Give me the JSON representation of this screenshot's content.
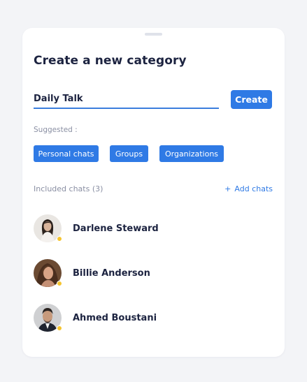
{
  "dialog": {
    "title": "Create a new category",
    "name_input_value": "Daily Talk",
    "create_label": "Create"
  },
  "suggested": {
    "label": "Suggested :",
    "chips": [
      "Personal chats",
      "Groups",
      "Organizations"
    ]
  },
  "included": {
    "label": "Included chats (3)",
    "add_label": "Add chats",
    "add_icon": "+",
    "chats": [
      {
        "name": "Darlene Steward",
        "status": "away"
      },
      {
        "name": "Billie Anderson",
        "status": "away"
      },
      {
        "name": "Ahmed Boustani",
        "status": "away"
      }
    ]
  },
  "colors": {
    "accent": "#2f7ae5",
    "status_away": "#f5c42e",
    "text_primary": "#1c2340",
    "text_muted": "#8a8fa3",
    "background": "#f3f4f7"
  }
}
